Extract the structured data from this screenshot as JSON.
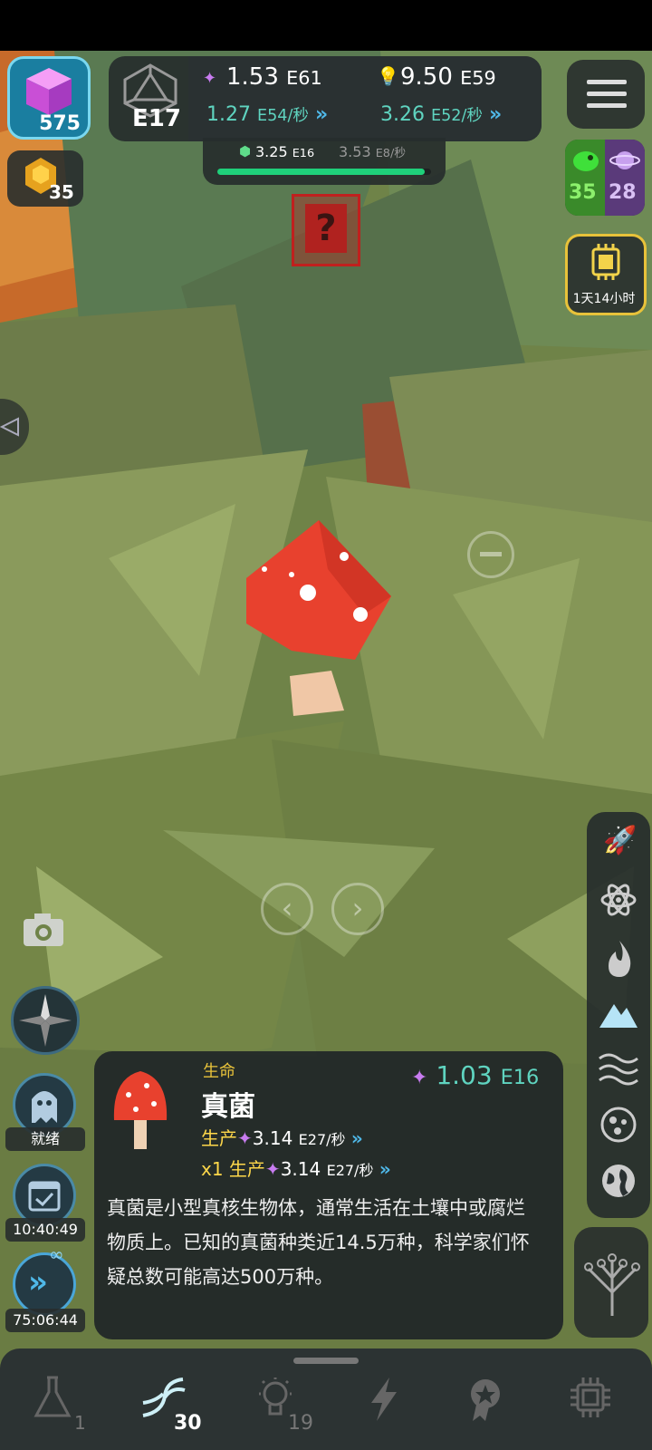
{
  "top_left": {
    "cube_count": "575",
    "honeycomb_count": "35"
  },
  "stats": {
    "era": "E17",
    "entropy_value": "1.53",
    "entropy_exp": "E61",
    "entropy_rate": "1.27",
    "entropy_rate_exp": "E54/秒",
    "idea_value": "9.50",
    "idea_exp": "E59",
    "idea_rate": "3.26",
    "idea_rate_exp": "E52/秒",
    "gem_value": "3.25",
    "gem_exp": "E16",
    "gem_rate": "3.53",
    "gem_rate_exp": "E8/秒",
    "gem_progress": 0.97
  },
  "right_badges": {
    "dino_count": "35",
    "planet_count": "28",
    "chip_timer": "1天14小时"
  },
  "left_side": {
    "ghost_status": "就绪",
    "calendar_timer": "10:40:49",
    "boost_timer": "75:06:44"
  },
  "info_card": {
    "category": "生命",
    "title": "真菌",
    "cost": "1.03",
    "cost_exp": "E16",
    "produce_label": "生产",
    "produce_value": "3.14",
    "produce_exp": "E27/秒",
    "multiplier": "x1",
    "produce2_label": "生产",
    "produce2_value": "3.14",
    "produce2_exp": "E27/秒",
    "description": "真菌是小型真核生物体，通常生活在土壤中或腐烂物质上。已知的真菌种类近14.5万种，科学家们怀疑总数可能高达500万种。"
  },
  "bottom_nav": [
    {
      "icon": "flask-icon",
      "count": "1"
    },
    {
      "icon": "dna-icon",
      "count": "30"
    },
    {
      "icon": "lightbulb-icon",
      "count": "19"
    },
    {
      "icon": "lightning-icon",
      "count": ""
    },
    {
      "icon": "award-icon",
      "count": ""
    },
    {
      "icon": "chip-icon",
      "count": ""
    }
  ],
  "colors": {
    "teal": "#5fd4c0",
    "yellow": "#ffd84a",
    "chevron": "#4fb8e8",
    "mushroom": "#e8412e"
  }
}
